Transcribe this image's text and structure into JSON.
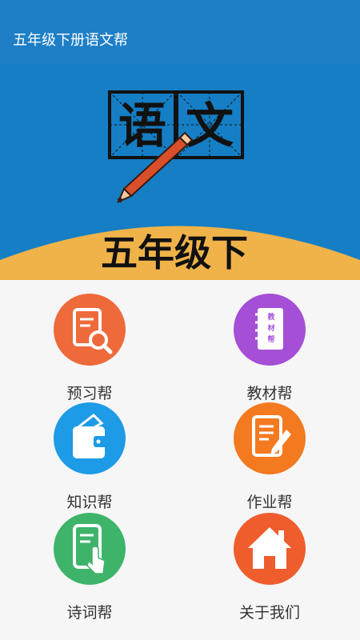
{
  "app_bar": {
    "title": "五年级下册语文帮"
  },
  "banner": {
    "glyph1": "语",
    "glyph2": "文",
    "grade_text": "五年级下"
  },
  "menu": [
    {
      "label": "预习帮",
      "color": "#ef6a3b",
      "icon": "document-search-icon"
    },
    {
      "label": "教材帮",
      "color": "#a44fd6",
      "icon": "notebook-icon",
      "icon_text": [
        "教",
        "材",
        "帮"
      ]
    },
    {
      "label": "知识帮",
      "color": "#1d9be6",
      "icon": "wallet-icon"
    },
    {
      "label": "作业帮",
      "color": "#f47a20",
      "icon": "document-edit-icon"
    },
    {
      "label": "诗词帮",
      "color": "#3eb46a",
      "icon": "phone-touch-icon"
    },
    {
      "label": "关于我们",
      "color": "#ef5d2d",
      "icon": "home-icon"
    }
  ]
}
